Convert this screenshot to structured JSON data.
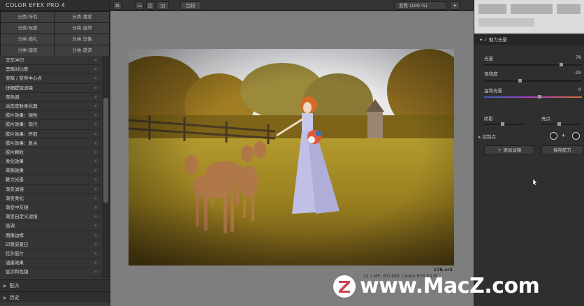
{
  "app": {
    "title": "COLOR EFEX PRO 4"
  },
  "categories": [
    "分类:所有",
    "分类:喜爱",
    "分类:玩度",
    "分类:自然",
    "分类:婚礼",
    "分类:肖像",
    "分类:建筑",
    "分类:旅游"
  ],
  "filters": [
    "交叉冲印",
    "黑暗对比度",
    "变暗 / 变亮中心点",
    "详细提取滤镜",
    "双色调",
    "动态皮肤柔化器",
    "胶片效果：褪色",
    "胶片效果：现代",
    "胶片效果：怀旧",
    "胶片效果：复古",
    "胶片颗粒",
    "柔化效果",
    "草隙效果",
    "魅力光晕",
    "渐变滤镜",
    "渐变柔化",
    "渐变中灰镜",
    "渐变自定义滤镜",
    "高调",
    "图像边框",
    "印第安夏日",
    "红外胶片",
    "油墨效果",
    "层次和色镜"
  ],
  "bottom_tabs": {
    "recipes": "配方",
    "history": "历史"
  },
  "toolbar": {
    "compare": "比较",
    "zoom": "变焦 (100 %)"
  },
  "image": {
    "filename": "176.cr2",
    "info": "22.1 MP, ISO 800, Canon EOS 50 M..."
  },
  "right_panel": {
    "section": "魅力光晕",
    "glow_label": "光晕",
    "glow_value": "78",
    "saturation_label": "饱和度",
    "saturation_value": "-29",
    "warmth_label": "温和光晕",
    "warmth_value": "0",
    "shadows_label": "阴影",
    "highlights_label": "亮点",
    "control_points_label": "控制点",
    "add_filter_label": "添加滤镜",
    "save_recipe_label": "保存配方"
  },
  "watermark": {
    "text": "www.MacZ.com",
    "logo": "Z"
  },
  "colors": {
    "panel": "#3a3a3a",
    "canvas": "#7e7e7e",
    "accent_temp_start": "#3a60c0",
    "accent_temp_end": "#d07030"
  },
  "sliders": {
    "glow": 0.78,
    "saturation": 0.35,
    "warmth": 0.55,
    "shadows": 0.3,
    "highlights": 0.3
  }
}
